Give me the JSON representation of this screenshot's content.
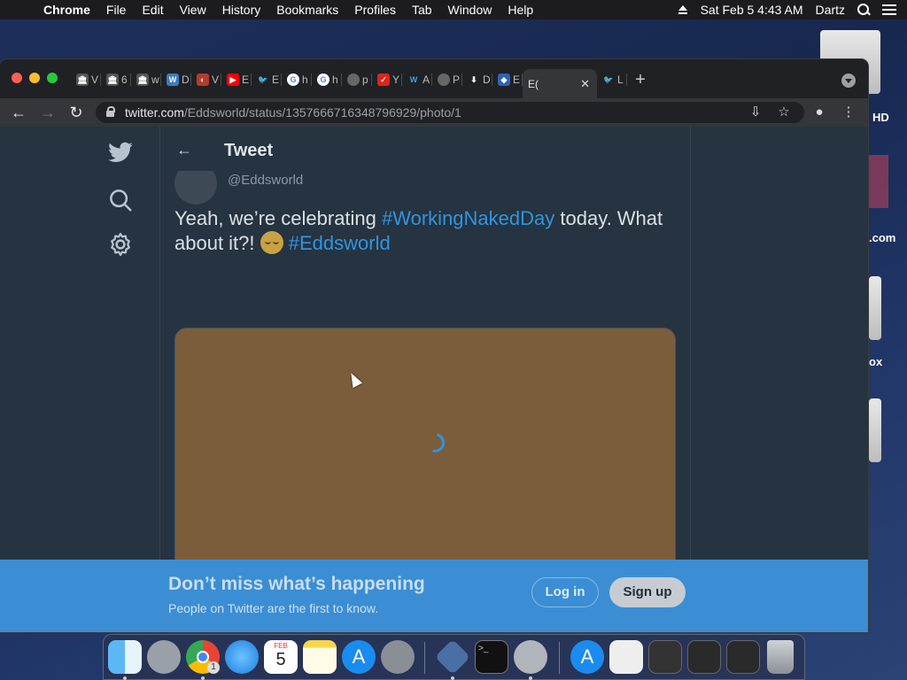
{
  "menubar": {
    "app_name": "Chrome",
    "items": [
      "File",
      "Edit",
      "View",
      "History",
      "Bookmarks",
      "Profiles",
      "Tab",
      "Window",
      "Help"
    ],
    "datetime": "Sat Feb 5  4:43 AM",
    "user": "Dartz"
  },
  "desktop": {
    "labels": [
      "HD",
      ".com",
      "ox"
    ]
  },
  "browser": {
    "tabs": [
      {
        "letter": "V",
        "icon": "museum-icon"
      },
      {
        "letter": "6",
        "icon": "museum-icon"
      },
      {
        "letter": "w",
        "icon": "museum-icon"
      },
      {
        "letter": "D",
        "icon": "app-icon"
      },
      {
        "letter": "V",
        "icon": "app-icon"
      },
      {
        "letter": "E",
        "icon": "youtube-icon"
      },
      {
        "letter": "E",
        "icon": "twitter-icon"
      },
      {
        "letter": "h",
        "icon": "google-icon"
      },
      {
        "letter": "h",
        "icon": "google-icon"
      },
      {
        "letter": "p",
        "icon": "globe-icon"
      },
      {
        "letter": "Y",
        "icon": "app-icon"
      },
      {
        "letter": "A",
        "icon": "wikipedia-icon"
      },
      {
        "letter": "P",
        "icon": "globe-icon"
      },
      {
        "letter": "D",
        "icon": "download-icon"
      },
      {
        "letter": "E",
        "icon": "app-icon"
      }
    ],
    "active_tab_label": "E(",
    "last_tab_label": "L",
    "url_host": "twitter.com",
    "url_path": "/Eddsworld/status/1357666716348796929/photo/1"
  },
  "tweet": {
    "header_title": "Tweet",
    "handle": "@Eddsworld",
    "text_part1": "Yeah, we’re celebrating ",
    "hashtag1": "#WorkingNakedDay",
    "text_part2": " today. What about it?! ",
    "hashtag2": "#Eddsworld",
    "photo_color": "#7c5d3b"
  },
  "banner": {
    "title": "Don’t miss what’s happening",
    "subtitle": "People on Twitter are the first to know.",
    "login_label": "Log in",
    "signup_label": "Sign up"
  },
  "dock": {
    "calendar_month": "FEB",
    "calendar_day": "5",
    "chrome_badge": "1"
  },
  "colors": {
    "accent": "#2f95e0",
    "banner": "#3b8ed4"
  }
}
